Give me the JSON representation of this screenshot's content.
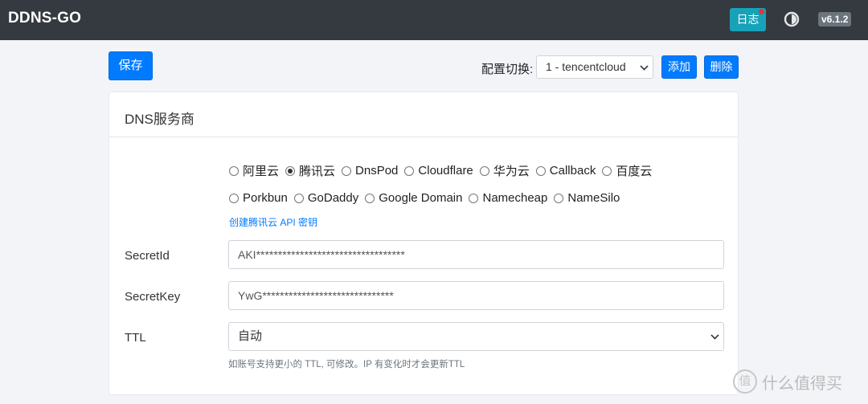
{
  "app": {
    "title": "DDNS-GO",
    "version": "v6.1.2"
  },
  "navbar": {
    "log_label": "日志",
    "theme_icon": "contrast-icon"
  },
  "toolbar": {
    "save_label": "保存",
    "config_label": "配置切换:",
    "config_selected": "1 - tencentcloud",
    "add_label": "添加",
    "delete_label": "删除"
  },
  "card": {
    "title": "DNS服务商",
    "providers_row1": [
      {
        "label": "阿里云",
        "checked": false
      },
      {
        "label": "腾讯云",
        "checked": true
      },
      {
        "label": "DnsPod",
        "checked": false
      },
      {
        "label": "Cloudflare",
        "checked": false
      },
      {
        "label": "华为云",
        "checked": false
      },
      {
        "label": "Callback",
        "checked": false
      },
      {
        "label": "百度云",
        "checked": false
      }
    ],
    "providers_row2": [
      {
        "label": "Porkbun",
        "checked": false
      },
      {
        "label": "GoDaddy",
        "checked": false
      },
      {
        "label": "Google Domain",
        "checked": false
      },
      {
        "label": "Namecheap",
        "checked": false
      },
      {
        "label": "NameSilo",
        "checked": false
      }
    ],
    "create_key_link": "创建腾讯云 API 密钥",
    "secret_id": {
      "label": "SecretId",
      "value": "AKI**********************************"
    },
    "secret_key": {
      "label": "SecretKey",
      "value": "YwG******************************"
    },
    "ttl": {
      "label": "TTL",
      "value": "自动",
      "hint": "如账号支持更小的 TTL, 可修改。IP 有变化时才会更新TTL"
    }
  },
  "watermark": {
    "icon_text": "值",
    "text": "什么值得买"
  }
}
